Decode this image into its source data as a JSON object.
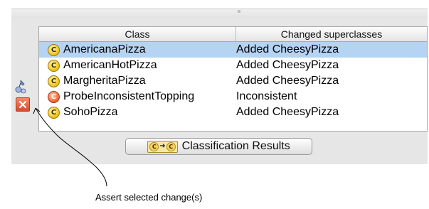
{
  "table": {
    "columns": [
      "Class",
      "Changed superclasses"
    ],
    "rows": [
      {
        "icon": "class-icon",
        "class": "AmericanaPizza",
        "change": "Added CheesyPizza",
        "selected": true
      },
      {
        "icon": "class-icon",
        "class": "AmericanHotPizza",
        "change": "Added CheesyPizza",
        "selected": false
      },
      {
        "icon": "class-icon",
        "class": "MargheritaPizza",
        "change": "Added CheesyPizza",
        "selected": false
      },
      {
        "icon": "inconsistent-class-icon",
        "class": "ProbeInconsistentTopping",
        "change": "Inconsistent",
        "selected": false
      },
      {
        "icon": "class-icon",
        "class": "SohoPizza",
        "change": "Added CheesyPizza",
        "selected": false
      }
    ],
    "icon_glyph": "C"
  },
  "button": {
    "label": "Classification Results"
  },
  "annotation": {
    "text": "Assert selected change(s)"
  },
  "colors": {
    "selection": "#b5d3f3",
    "class_icon": "#f2c51c",
    "inconsistent_icon": "#ee6a3a",
    "panel_bg": "#e6e6e6"
  }
}
